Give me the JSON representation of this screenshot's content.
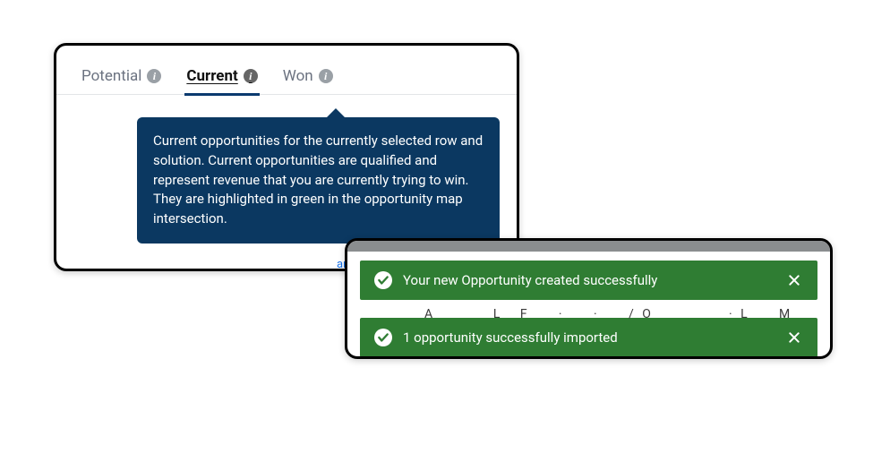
{
  "tabs": {
    "potential": {
      "label": "Potential"
    },
    "current": {
      "label": "Current"
    },
    "won": {
      "label": "Won"
    }
  },
  "tooltip": {
    "text": "Current opportunities for the currently selected row and solution. Current opportunities are qualified and represent revenue that you are currently trying to win. They are highlighted in green in the opportunity map intersection."
  },
  "toasts": [
    {
      "message": "Your new Opportunity created successfully"
    },
    {
      "message": "1 opportunity successfully imported"
    }
  ],
  "stray": {
    "link_fragment": "an"
  },
  "colors": {
    "tooltip_bg": "#0b3861",
    "toast_bg": "#2f7d33"
  }
}
